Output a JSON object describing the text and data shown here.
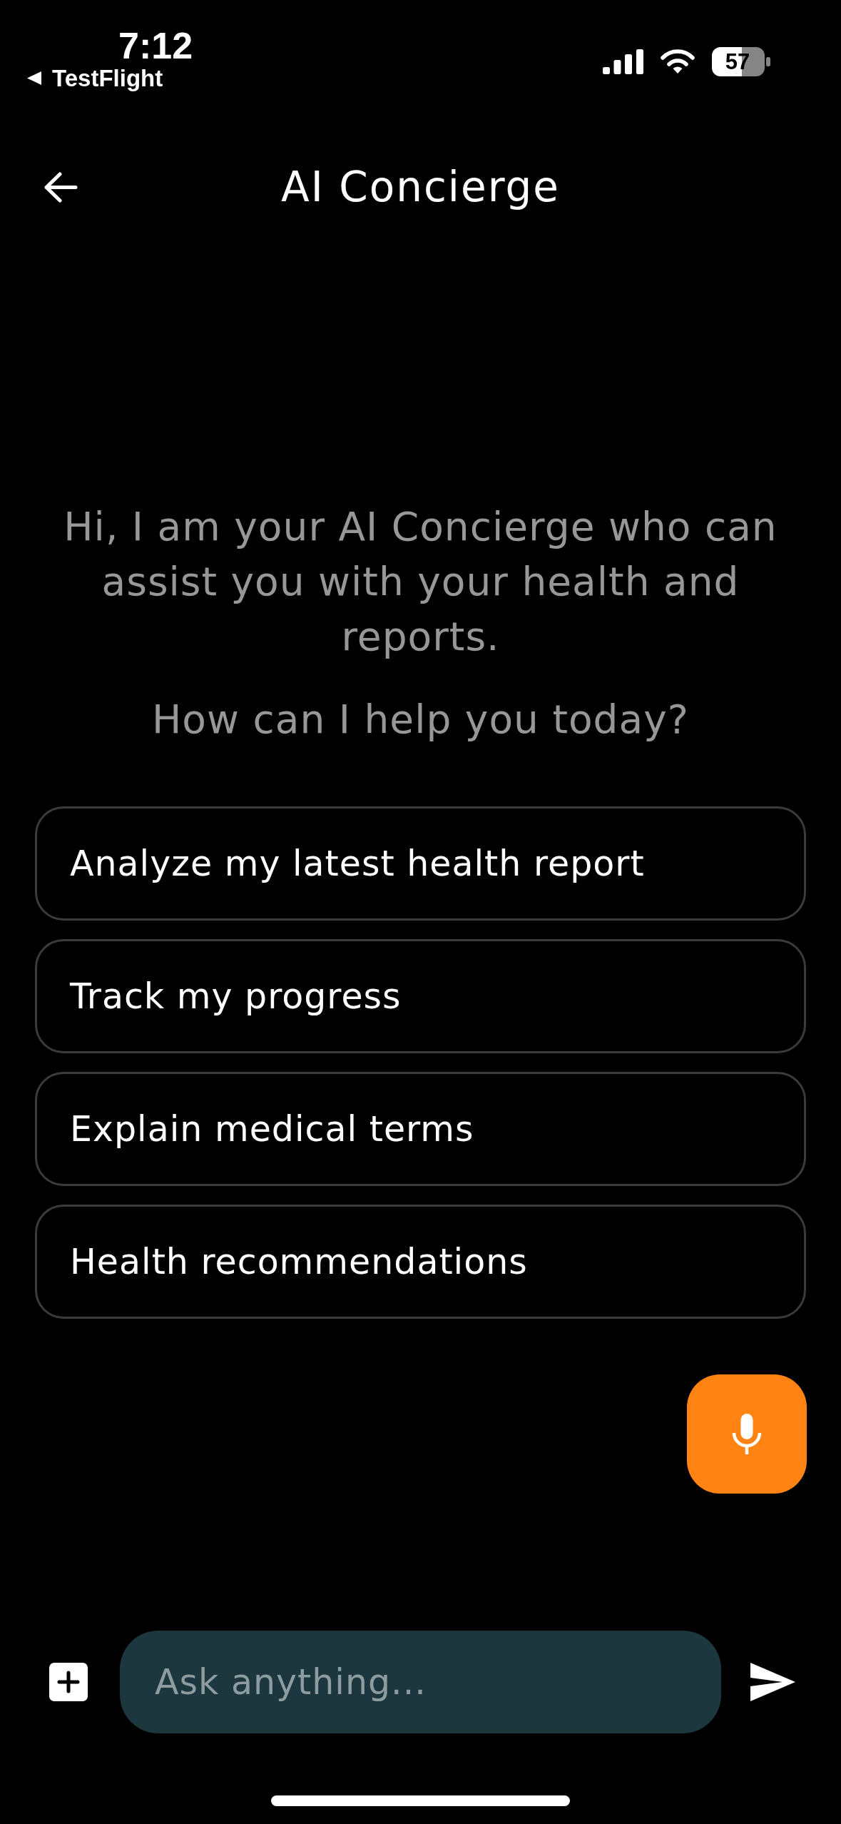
{
  "status_bar": {
    "time": "7:12",
    "back_label": "TestFlight",
    "battery": "57"
  },
  "header": {
    "title": "AI Concierge"
  },
  "intro": {
    "greeting": "Hi, I am your AI Concierge who can assist you with your health and reports.",
    "prompt": "How can I help you today?"
  },
  "suggestions": [
    {
      "label": "Analyze my latest health report"
    },
    {
      "label": "Track my progress"
    },
    {
      "label": "Explain medical terms"
    },
    {
      "label": "Health recommendations"
    }
  ],
  "composer": {
    "placeholder": "Ask anything..."
  }
}
